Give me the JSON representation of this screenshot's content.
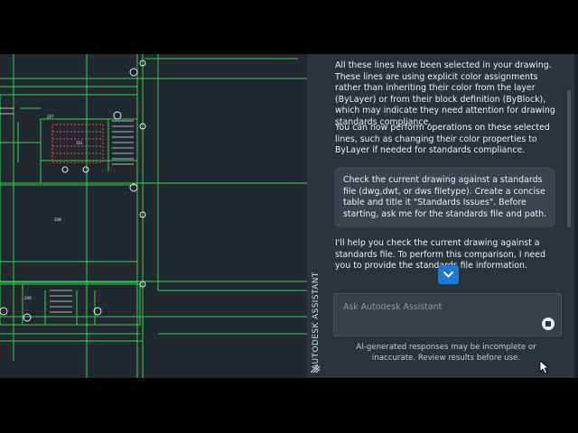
{
  "assistant": {
    "side_title": "AUTODESK ASSISTANT",
    "messages": [
      "All these lines have been selected in your drawing. These lines are using explicit color assignments rather than inheriting their color from the layer (ByLayer) or from their block definition (ByBlock), which may indicate they need attention for drawing standards compliance.",
      "You can now perform operations on these selected lines, such as changing their color properties to ByLayer if needed for standards compliance."
    ],
    "user_prompt": "Check the current drawing against a standards file (dwg,dwt, or dws filetype). Create a concise table and title it \"Standards Issues\". Before starting, ask me for the standards file and path.",
    "response": "I'll help you check the current drawing against a standards file. To perform this comparison, I need you to provide the standards file information.",
    "input_placeholder": "Ask Autodesk Assistant",
    "disclaimer": "AI-generated responses may be incomplete or inaccurate. Review results before use."
  },
  "drawing": {
    "room_labels": [
      "207",
      "301",
      "208",
      "209"
    ]
  },
  "colors": {
    "accent": "#1f78d1",
    "panel_bg": "#2b333b",
    "canvas_bg": "#212830",
    "cad_green": "#2fd24a",
    "cad_red": "#ff3b3b"
  },
  "icons": [
    "chevron-down-icon",
    "stop-icon",
    "grip-icon",
    "cursor-icon"
  ]
}
